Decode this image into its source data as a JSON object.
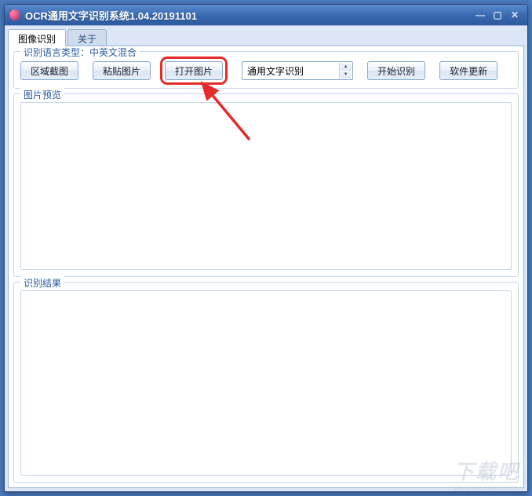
{
  "window": {
    "title": "OCR通用文字识别系统1.04.20191101"
  },
  "tabs": {
    "image_recognition": "图像识别",
    "about": "关于"
  },
  "language_group": {
    "label": "识别语言类型：中英文混合"
  },
  "toolbar": {
    "area_screenshot": "区域截图",
    "paste_image": "粘贴图片",
    "open_image": "打开图片",
    "start_recognition": "开始识别",
    "software_update": "软件更新"
  },
  "select": {
    "selected": "通用文字识别"
  },
  "preview_group": {
    "label": "图片预览"
  },
  "result_group": {
    "label": "识别结果"
  },
  "watermark": {
    "main": "下载吧",
    "sub": "www.xiazaiba.com"
  },
  "annotation": {
    "highlight_color": "#e52a2a"
  }
}
